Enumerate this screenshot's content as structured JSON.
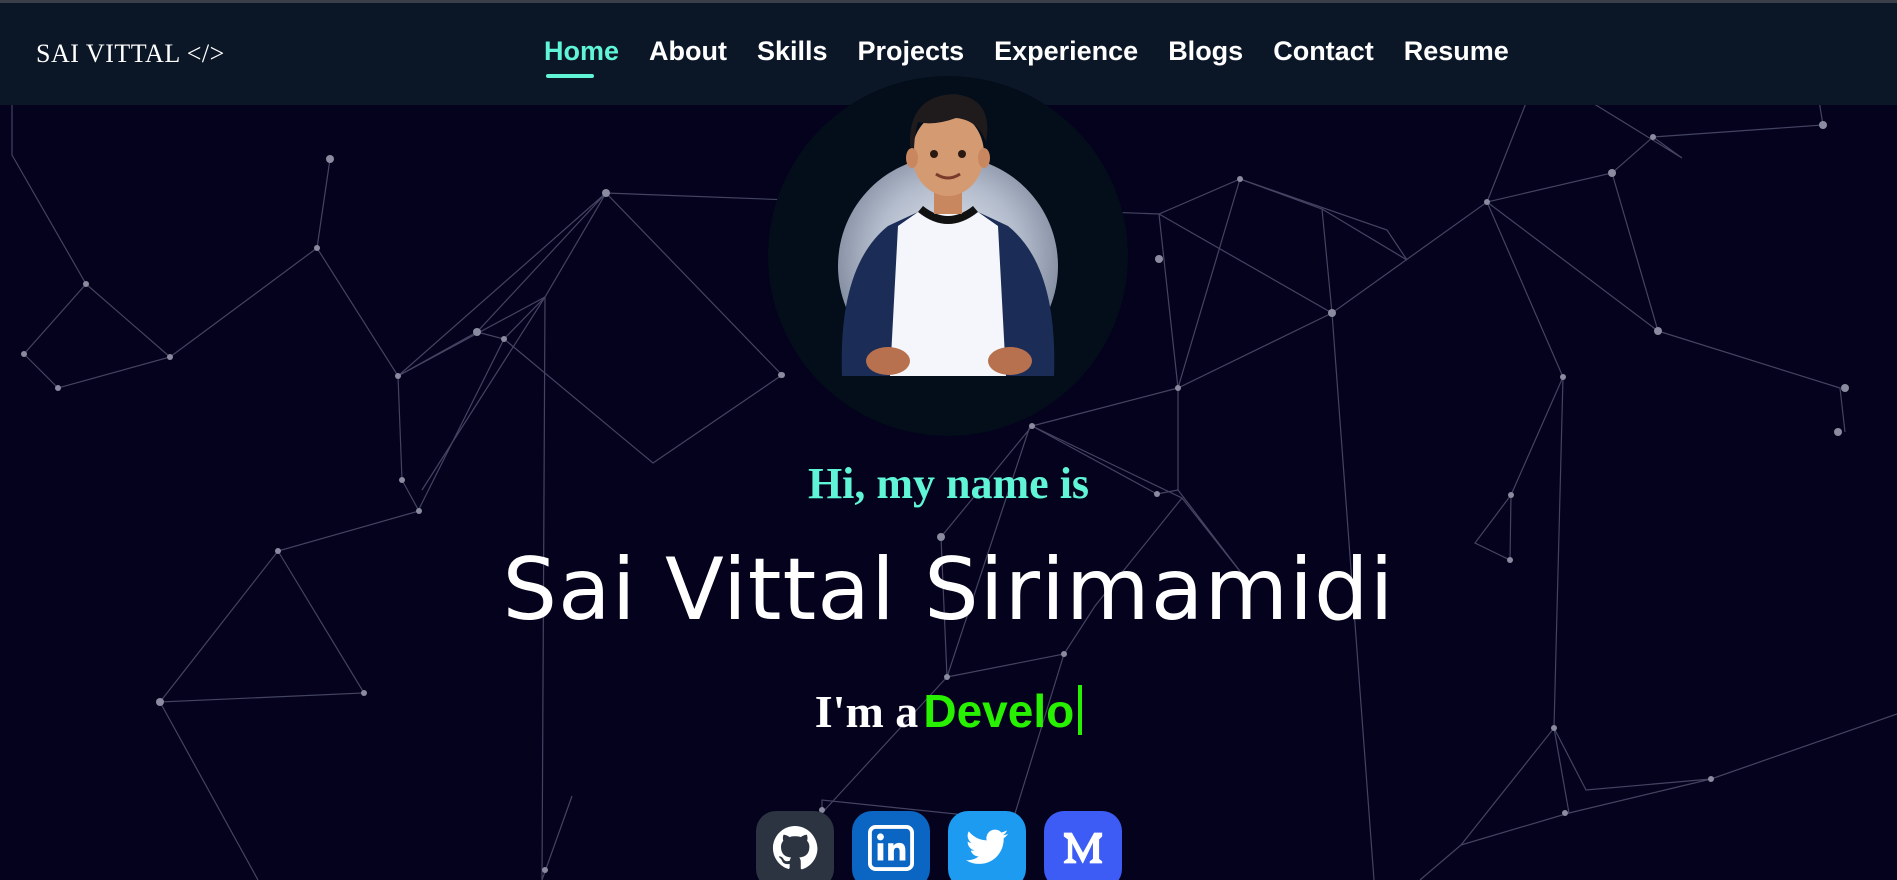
{
  "brand": {
    "title": "SAI VITTAL </>"
  },
  "nav": {
    "items": [
      {
        "label": "Home",
        "active": true
      },
      {
        "label": "About",
        "active": false
      },
      {
        "label": "Skills",
        "active": false
      },
      {
        "label": "Projects",
        "active": false
      },
      {
        "label": "Experience",
        "active": false
      },
      {
        "label": "Blogs",
        "active": false
      },
      {
        "label": "Contact",
        "active": false
      },
      {
        "label": "Resume",
        "active": false
      }
    ]
  },
  "hero": {
    "greeting": "Hi, my name is",
    "name": "Sai Vittal Sirimamidi",
    "typing_prefix": "I'm a",
    "typing_role": "Develo"
  },
  "socials": [
    {
      "icon": "github-icon",
      "color": "#2b3440"
    },
    {
      "icon": "linkedin-icon",
      "color": "#0a66c2"
    },
    {
      "icon": "twitter-icon",
      "color": "#1d9bf0"
    },
    {
      "icon": "medium-icon",
      "color": "#3c5cf5"
    }
  ],
  "colors": {
    "background": "#04021c",
    "navbar": "#0b1627",
    "accent": "#5ff5d6",
    "typing": "#27f000"
  }
}
